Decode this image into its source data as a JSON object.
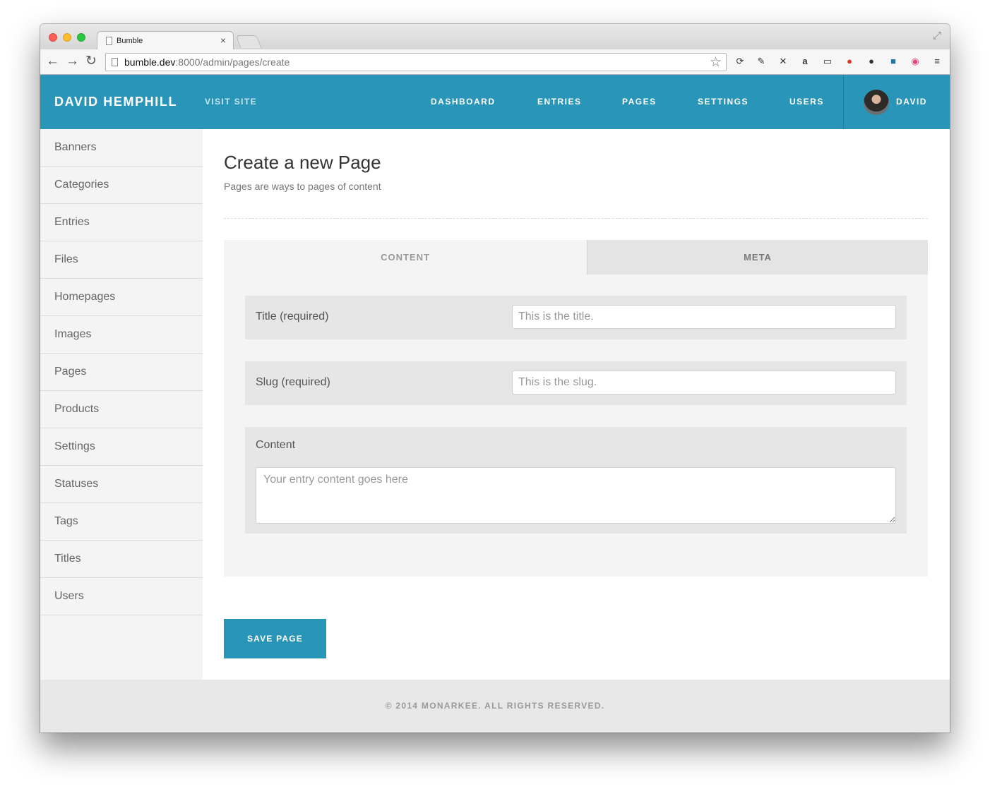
{
  "browser": {
    "tab_title": "Bumble",
    "tab_close": "×",
    "url_host": "bumble.dev",
    "url_rest": ":8000/admin/pages/create"
  },
  "header": {
    "brand": "DAVID HEMPHILL",
    "visit_site": "VISIT SITE",
    "nav": [
      "DASHBOARD",
      "ENTRIES",
      "PAGES",
      "SETTINGS",
      "USERS"
    ],
    "user_name": "DAVID"
  },
  "sidebar": {
    "items": [
      "Banners",
      "Categories",
      "Entries",
      "Files",
      "Homepages",
      "Images",
      "Pages",
      "Products",
      "Settings",
      "Statuses",
      "Tags",
      "Titles",
      "Users"
    ]
  },
  "main": {
    "title": "Create a new Page",
    "subtitle": "Pages are ways to pages of content",
    "tabs": {
      "content": "CONTENT",
      "meta": "META"
    },
    "fields": {
      "title_label": "Title (required)",
      "title_placeholder": "This is the title.",
      "slug_label": "Slug (required)",
      "slug_placeholder": "This is the slug.",
      "content_label": "Content",
      "content_placeholder": "Your entry content goes here"
    },
    "save_label": "SAVE PAGE"
  },
  "footer": {
    "text": "© 2014 MONARKEE. ALL RIGHTS RESERVED."
  },
  "colors": {
    "brand": "#2895b9",
    "sidebar_bg": "#f4f4f4",
    "footer_bg": "#e8e8e8"
  }
}
